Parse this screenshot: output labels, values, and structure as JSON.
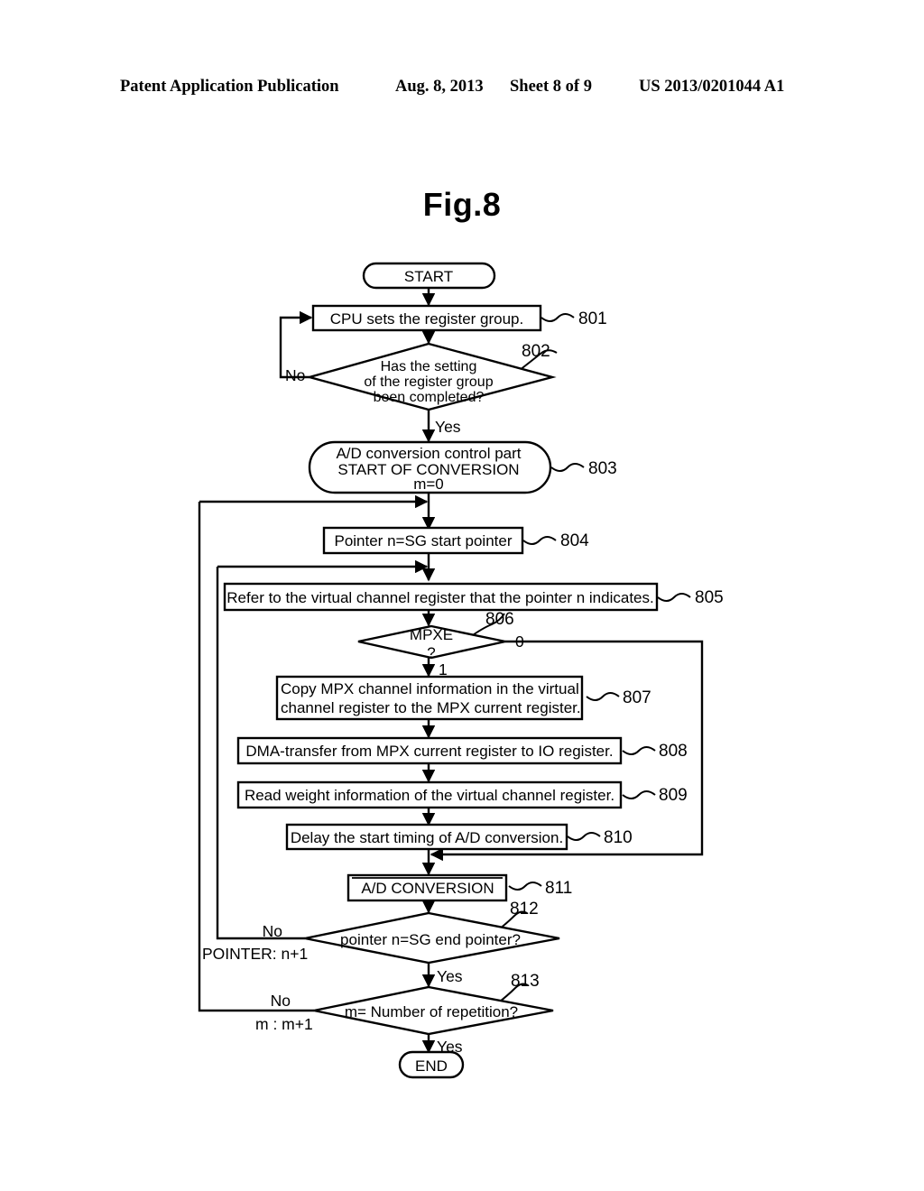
{
  "header": {
    "publication": "Patent Application Publication",
    "date": "Aug. 8, 2013",
    "sheet": "Sheet 8 of 9",
    "patent_number": "US 2013/0201044 A1"
  },
  "figure": {
    "title": "Fig.8"
  },
  "flowchart": {
    "nodes": {
      "start": {
        "label": "START",
        "shape": "stadium"
      },
      "n801": {
        "label": "CPU sets the register group.",
        "ref": "801",
        "shape": "rect"
      },
      "n802": {
        "line1": "Has the setting",
        "line2": "of the register group",
        "line3": "been completed?",
        "ref": "802",
        "shape": "diamond"
      },
      "n803": {
        "line1": "A/D conversion control part",
        "line2": "START OF CONVERSION",
        "line3": "m=0",
        "ref": "803",
        "shape": "stadium"
      },
      "n804": {
        "label": "Pointer n=SG start pointer",
        "ref": "804",
        "shape": "rect"
      },
      "n805": {
        "label": "Refer to the virtual channel register that the pointer n indicates.",
        "ref": "805",
        "shape": "rect"
      },
      "n806": {
        "line1": "MPXE",
        "line2": "?",
        "ref": "806",
        "shape": "diamond"
      },
      "n807": {
        "line1": "Copy MPX channel information in the virtual",
        "line2": "channel register to the MPX current register.",
        "ref": "807",
        "shape": "rect"
      },
      "n808": {
        "label": "DMA-transfer from MPX current register to IO register.",
        "ref": "808",
        "shape": "rect"
      },
      "n809": {
        "label": "Read weight information of the virtual channel register.",
        "ref": "809",
        "shape": "rect"
      },
      "n810": {
        "label": "Delay the start timing of A/D conversion.",
        "ref": "810",
        "shape": "rect"
      },
      "n811": {
        "label": "A/D CONVERSION",
        "ref": "811",
        "shape": "predefined-process"
      },
      "n812": {
        "label": "pointer n=SG end pointer?",
        "ref": "812",
        "shape": "diamond"
      },
      "n813": {
        "label": "m= Number of repetition?",
        "ref": "813",
        "shape": "diamond"
      },
      "end": {
        "label": "END",
        "shape": "stadium"
      }
    },
    "edge_labels": {
      "e802_no": "No",
      "e802_yes": "Yes",
      "e806_zero": "0",
      "e806_one": "1",
      "e812_no": "No",
      "e812_no_action": "POINTER: n+1",
      "e812_yes": "Yes",
      "e813_no": "No",
      "e813_no_action": "m : m+1",
      "e813_yes": "Yes"
    }
  }
}
